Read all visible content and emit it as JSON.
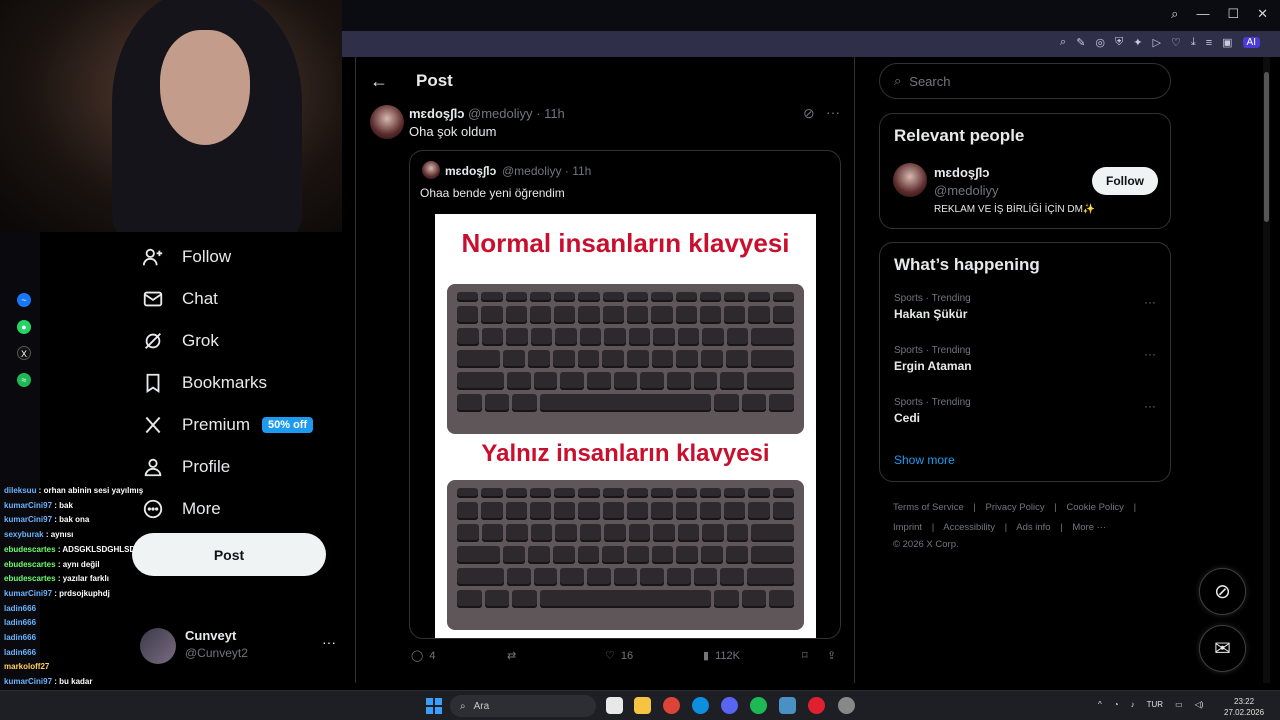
{
  "browser": {
    "toolbar_ai_label": "AI"
  },
  "sidebar": {
    "items": [
      {
        "label": "Follow",
        "icon": "add-user-icon"
      },
      {
        "label": "Chat",
        "icon": "envelope-icon"
      },
      {
        "label": "Grok",
        "icon": "grok-icon"
      },
      {
        "label": "Bookmarks",
        "icon": "bookmark-icon"
      },
      {
        "label": "Premium",
        "icon": "x-logo-icon",
        "badge": "50% off"
      },
      {
        "label": "Profile",
        "icon": "person-icon"
      },
      {
        "label": "More",
        "icon": "more-circle-icon"
      }
    ],
    "post_button": "Post",
    "account": {
      "name": "Cunveyt",
      "handle": "@Cunveyt2"
    }
  },
  "chat": {
    "lines": [
      {
        "user": "dileksuu",
        "msg": "orhan abinin sesi yayılmış"
      },
      {
        "user": "kumarCini97",
        "msg": "bak"
      },
      {
        "user": "kumarCini97",
        "msg": "bak ona"
      },
      {
        "user": "sexyburak",
        "msg": "aynısı"
      },
      {
        "user": "ebudescartes",
        "msg": "ADSGKLSDGHLSDFJRFS"
      },
      {
        "user": "ebudescartes",
        "msg": "aynı değil"
      },
      {
        "user": "ebudescartes",
        "msg": "yazılar farklı"
      },
      {
        "user": "kumarCini97",
        "msg": "prdsojkuphdj"
      },
      {
        "user": "ladin666",
        "msg": ""
      },
      {
        "user": "ladin666",
        "msg": ""
      },
      {
        "user": "ladin666",
        "msg": ""
      },
      {
        "user": "ladin666",
        "msg": ""
      },
      {
        "user": "markoloff27",
        "msg": ""
      },
      {
        "user": "kumarCini97",
        "msg": "bu kadar"
      }
    ]
  },
  "main": {
    "title": "Post",
    "post": {
      "name": "mɛdoş∫lↄ",
      "handle": "@medoliyy",
      "time": "· 11h",
      "text": "Oha şok oldum"
    },
    "quote": {
      "name": "mɛdoş∫lↄ",
      "handle": "@medoliyy",
      "time": "· 11h",
      "text": "Ohaa bende yeni öğrendim",
      "meme_top": "Normal insanların klavyesi",
      "meme_bottom": "Yalnız insanların klavyesi"
    },
    "actions": {
      "replies": "4",
      "retweets": "",
      "likes": "16",
      "views": "112K"
    }
  },
  "right": {
    "search_placeholder": "Search",
    "relevant": {
      "title": "Relevant people",
      "name": "mɛdoş∫lↄ",
      "handle": "@medoliyy",
      "bio": "REKLAM VE İŞ BİRLİĞİ İÇİN DM✨",
      "follow": "Follow"
    },
    "happening": {
      "title": "What’s happening",
      "trends": [
        {
          "meta": "Sports · Trending",
          "name": "Hakan Şükür"
        },
        {
          "meta": "Sports · Trending",
          "name": "Ergin Ataman"
        },
        {
          "meta": "Sports · Trending",
          "name": "Cedi"
        }
      ],
      "show_more": "Show more"
    },
    "footer": {
      "links": [
        "Terms of Service",
        "|",
        "Privacy Policy",
        "|",
        "Cookie Policy",
        "|",
        "Imprint",
        "|",
        "Accessibility",
        "|",
        "Ads info",
        "|",
        "More ···"
      ],
      "copyright": "© 2026 X Corp."
    }
  },
  "taskbar": {
    "search": "Ara",
    "lang": "TUR",
    "time": "23:22",
    "date": "27.02.2026"
  },
  "colors": {
    "accent": "#1d9bf0",
    "meme_red": "#c8102e",
    "toolbar": "#2f2f4a"
  }
}
